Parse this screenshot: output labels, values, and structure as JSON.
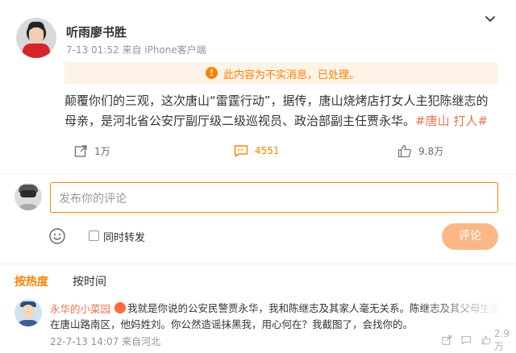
{
  "post": {
    "username": "听雨廖书胜",
    "meta": "7-13 01:52  来自 iPhone客户端",
    "notice": "此内容为不实消息，已处理。",
    "notice_icon": "!",
    "text": "颠覆你们的三观，这次唐山“雷霆行动”，据传，唐山烧烤店打女人主犯陈继志的母亲，是河北省公安厅副厅级二级巡视员、政治部副主任贾永华。",
    "hashtag": "#唐山 打人#",
    "repost_count": "1万",
    "comment_count": "4551",
    "like_count": "9.8万"
  },
  "composer": {
    "placeholder": "发布你的评论",
    "repost_label": "同时转发",
    "submit_label": "评论"
  },
  "sort": {
    "hot": "按热度",
    "time": "按时间"
  },
  "comment": {
    "name": "永华的小菜园",
    "text": "我就是你说的公安民警贾永华，我和陈继志及其家人毫无关系。陈继志及其父母生活在唐山路南区，他妈姓刘。你公然造谣抹黑我，用心何在？我截图了，会找你的。",
    "meta": "22-7-13 14:07  来自河北",
    "like_count": "2.9万"
  },
  "colors": {
    "accent": "#ff8200",
    "hashtag": "#eb7350",
    "notice_bg": "#fdf3e6",
    "submit_bg": "#fbb886"
  }
}
